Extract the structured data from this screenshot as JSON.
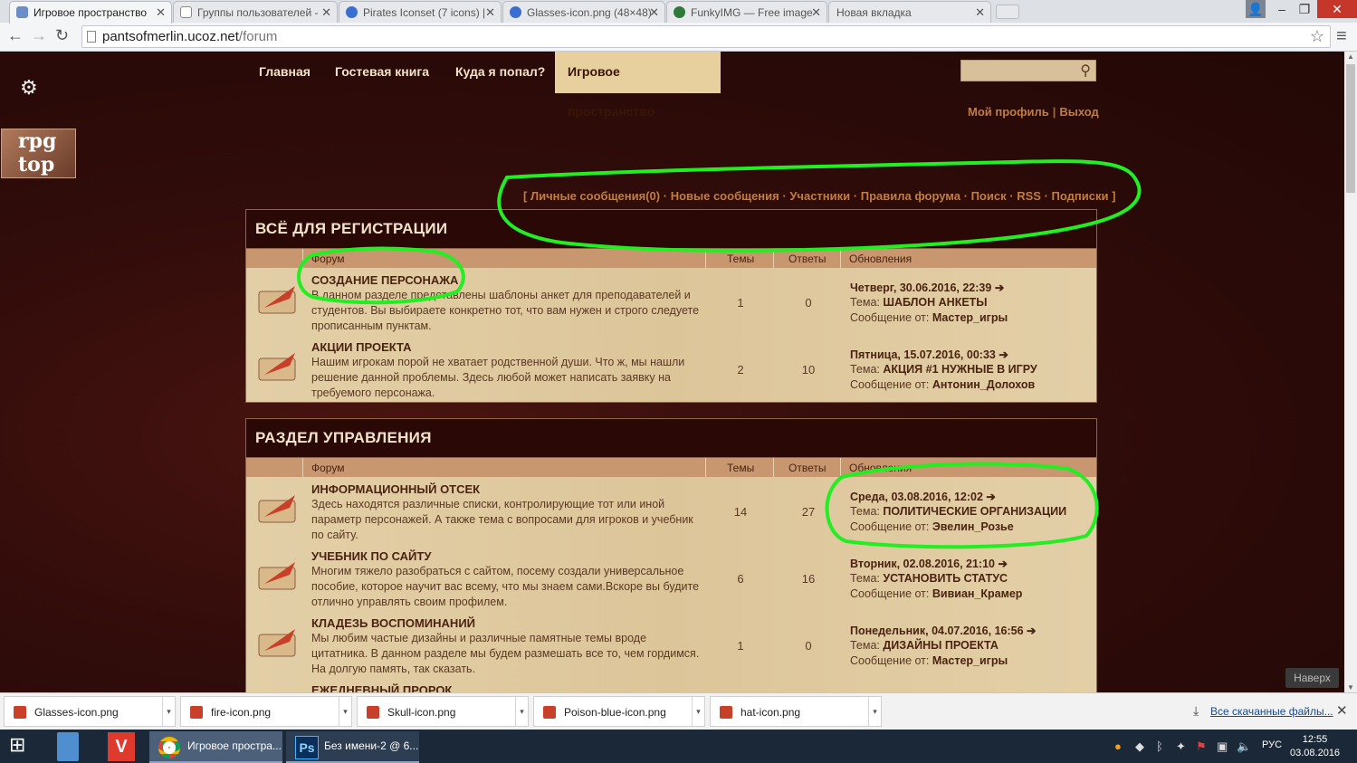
{
  "tabs": [
    {
      "title": "Игровое пространство",
      "active": true
    },
    {
      "title": "Группы пользователей -",
      "active": false
    },
    {
      "title": "Pirates Iconset (7 icons) |",
      "active": false
    },
    {
      "title": "Glasses-icon.png (48×48)",
      "active": false
    },
    {
      "title": "FunkyIMG — Free image",
      "active": false
    },
    {
      "title": "Новая вкладка",
      "active": false
    }
  ],
  "address": {
    "host": "pantsofmerlin.ucoz.net",
    "path": "/forum"
  },
  "nav": {
    "items": [
      "Главная",
      "Гостевая книга",
      "Куда я попал?",
      "Игровое пространство"
    ],
    "active_index": 3
  },
  "logo_text": "rpg top",
  "user_links": {
    "profile": "Мой профиль",
    "sep": "|",
    "logout": "Выход"
  },
  "forum_links": {
    "open": "[",
    "items": [
      "Личные сообщения(0)",
      "Новые сообщения",
      "Участники",
      "Правила форума",
      "Поиск",
      "RSS",
      "Подписки"
    ],
    "sep": "·",
    "close": "]"
  },
  "columns": {
    "forum": "Форум",
    "themes": "Темы",
    "replies": "Ответы",
    "updates": "Обновления"
  },
  "topic_label": "Тема:",
  "author_label": "Сообщение от:",
  "sections": [
    {
      "title": "ВСЁ ДЛЯ РЕГИСТРАЦИИ",
      "rows": [
        {
          "title": "СОЗДАНИЕ ПЕРСОНАЖА",
          "desc": "В данном разделе представлены шаблоны анкет для преподавателей и студентов. Вы выбираете конкретно тот, что вам нужен и строго следуете прописанным пунктам.",
          "themes": "1",
          "replies": "0",
          "date": "Четверг, 30.06.2016, 22:39",
          "topic": "ШАБЛОН АНКЕТЫ",
          "author": "Мастер_игры"
        },
        {
          "title": "АКЦИИ ПРОЕКТА",
          "desc": "Нашим игрокам порой не хватает родственной души. Что ж, мы нашли решение данной проблемы. Здесь любой может написать заявку на требуемого персонажа.",
          "themes": "2",
          "replies": "10",
          "date": "Пятница, 15.07.2016, 00:33",
          "topic": "АКЦИЯ #1 НУЖНЫЕ В ИГРУ",
          "author": "Антонин_Долохов"
        }
      ]
    },
    {
      "title": "РАЗДЕЛ УПРАВЛЕНИЯ",
      "rows": [
        {
          "title": "ИНФОРМАЦИОННЫЙ ОТСЕК",
          "desc": "Здесь находятся различные списки, контролирующие тот или иной параметр персонажей. А также тема с вопросами для игроков и учебник по сайту.",
          "themes": "14",
          "replies": "27",
          "date": "Среда, 03.08.2016, 12:02",
          "topic": "ПОЛИТИЧЕСКИЕ ОРГАНИЗАЦИИ",
          "author": "Эвелин_Розье"
        },
        {
          "title": "УЧЕБНИК ПО САЙТУ",
          "desc": "Многим тяжело разобраться с сайтом, посему создали универсальное пособие, которое научит вас всему, что мы знаем сами.Вскоре вы будите отлично управлять своим профилем.",
          "themes": "6",
          "replies": "16",
          "date": "Вторник, 02.08.2016, 21:10",
          "topic": "УСТАНОВИТЬ СТАТУС",
          "author": "Вивиан_Крамер"
        },
        {
          "title": "КЛАДЕЗЬ ВОСПОМИНАНИЙ",
          "desc": "Мы любим частые дизайны и различные памятные темы вроде цитатника. В данном разделе мы будем размешать все то, чем гордимся. На долгую память, так сказать.",
          "themes": "1",
          "replies": "0",
          "date": "Понедельник, 04.07.2016, 16:56",
          "topic": "ДИЗАЙНЫ ПРОЕКТА",
          "author": "Мастер_игры"
        },
        {
          "title": "ЕЖЕДНЕВНЫЙ ПРОРОК",
          "desc": "",
          "themes": "",
          "replies": "",
          "date": "",
          "topic": "",
          "author": ""
        }
      ]
    }
  ],
  "back_to_top": "Наверх",
  "downloads": [
    "Glasses-icon.png",
    "fire-icon.png",
    "Skull-icon.png",
    "Poison-blue-icon.png",
    "hat-icon.png"
  ],
  "all_downloads": "Все скачанные файлы...",
  "taskbar": {
    "apps": [
      "Игровое простра...",
      "Без имени-2 @ 6..."
    ],
    "lang": "РУС",
    "time": "12:55",
    "date": "03.08.2016"
  },
  "colors": {
    "site_bg": "#2a0a08",
    "panel": "#e2cda4",
    "header_bar": "#c89770",
    "link": "#c07d43",
    "annotation": "#22ee22"
  },
  "icons": [
    "settings-gear-icon",
    "star-bookmark-icon",
    "search-icon",
    "quill-scroll-icon",
    "file-icon",
    "download-icon"
  ]
}
